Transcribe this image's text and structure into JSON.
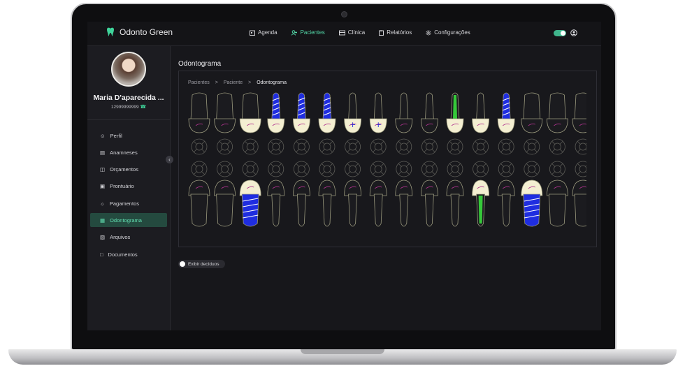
{
  "app": {
    "name": "Odonto Green"
  },
  "nav": [
    {
      "label": "Agenda",
      "icon": "calendar-icon"
    },
    {
      "label": "Pacientes",
      "icon": "users-icon",
      "active": true
    },
    {
      "label": "Clínica",
      "icon": "clinic-icon"
    },
    {
      "label": "Relatórios",
      "icon": "clipboard-icon"
    },
    {
      "label": "Configurações",
      "icon": "gear-icon"
    }
  ],
  "patient": {
    "name": "Maria D'aparecida ...",
    "phone": "12999999999"
  },
  "sidebar": {
    "items": [
      {
        "label": "Perfil",
        "icon": "user-icon"
      },
      {
        "label": "Anamneses",
        "icon": "form-icon"
      },
      {
        "label": "Orçamentos",
        "icon": "budget-icon"
      },
      {
        "label": "Prontuário",
        "icon": "record-icon"
      },
      {
        "label": "Pagamentos",
        "icon": "payment-icon"
      },
      {
        "label": "Odontograma",
        "icon": "odontogram-icon",
        "active": true
      },
      {
        "label": "Arquivos",
        "icon": "files-icon"
      },
      {
        "label": "Documentos",
        "icon": "document-icon"
      }
    ]
  },
  "page": {
    "title": "Odontograma"
  },
  "breadcrumb": [
    "Pacientes",
    "Paciente",
    "Odontograma"
  ],
  "deciduous_toggle": {
    "label": "Exibir decíduos",
    "checked": false
  },
  "colors": {
    "accent": "#53d6a7",
    "root_canal_blue": "#1f2de0",
    "root_canal_green": "#36c93a",
    "crown": "#f4efd2"
  },
  "teeth": {
    "upper": [
      {
        "crown": false,
        "root": "none"
      },
      {
        "crown": false,
        "root": "none"
      },
      {
        "crown": true,
        "root": "none"
      },
      {
        "crown": true,
        "root": "blue"
      },
      {
        "crown": true,
        "root": "blue"
      },
      {
        "crown": true,
        "root": "blue"
      },
      {
        "crown": true,
        "root": "none",
        "marks": "blue-cross"
      },
      {
        "crown": true,
        "root": "none",
        "marks": "blue-cross"
      },
      {
        "crown": false,
        "root": "none"
      },
      {
        "crown": false,
        "root": "none"
      },
      {
        "crown": true,
        "root": "green"
      },
      {
        "crown": true,
        "root": "none"
      },
      {
        "crown": true,
        "root": "blue"
      },
      {
        "crown": false,
        "root": "none"
      },
      {
        "crown": false,
        "root": "none"
      },
      {
        "crown": false,
        "root": "none"
      }
    ],
    "lower": [
      {
        "crown": false,
        "root": "none"
      },
      {
        "crown": false,
        "root": "none"
      },
      {
        "crown": true,
        "root": "blue"
      },
      {
        "crown": false,
        "root": "none"
      },
      {
        "crown": false,
        "root": "none"
      },
      {
        "crown": false,
        "root": "none"
      },
      {
        "crown": false,
        "root": "none"
      },
      {
        "crown": false,
        "root": "none"
      },
      {
        "crown": false,
        "root": "none"
      },
      {
        "crown": false,
        "root": "none"
      },
      {
        "crown": false,
        "root": "none"
      },
      {
        "crown": true,
        "root": "green"
      },
      {
        "crown": false,
        "root": "none"
      },
      {
        "crown": true,
        "root": "blue"
      },
      {
        "crown": false,
        "root": "none"
      },
      {
        "crown": false,
        "root": "none"
      }
    ]
  }
}
